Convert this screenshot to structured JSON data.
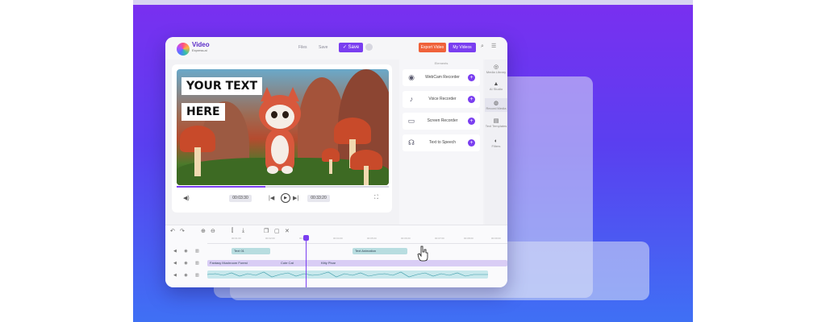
{
  "app": {
    "logo_text": "Video",
    "logo_sub": "Express.ai"
  },
  "toolbar": {
    "files_label": "Files",
    "save_small_label": "Save",
    "save_label": "✓ Save",
    "export_label": "Export Video",
    "my_videos_label": "My Videos"
  },
  "preview": {
    "text_line1": "YOUR TEXT",
    "text_line2": "HERE",
    "current_time": "00:03:30",
    "total_time": "00:33:20",
    "progress": 0.42
  },
  "recorders": {
    "header": "Elements",
    "items": [
      {
        "label": "WebCam Recorder",
        "icon": "webcam-icon",
        "symbol": "◉"
      },
      {
        "label": "Voice Recorder",
        "icon": "microphone-icon",
        "symbol": "♪"
      },
      {
        "label": "Screen Recorder",
        "icon": "monitor-icon",
        "symbol": "▭"
      },
      {
        "label": "Text to Speech",
        "icon": "speech-icon",
        "symbol": "☊"
      }
    ]
  },
  "rail": {
    "items": [
      {
        "label": "Media Library",
        "icon": "media-icon",
        "symbol": "◎"
      },
      {
        "label": "AI Studio",
        "icon": "ai-icon",
        "symbol": "▲"
      },
      {
        "label": "Record Media",
        "icon": "record-icon",
        "symbol": "◍"
      },
      {
        "label": "Text Templates",
        "icon": "text-icon",
        "symbol": "▤"
      },
      {
        "label": "Filters",
        "icon": "filter-icon",
        "symbol": "◐"
      }
    ]
  },
  "timeline": {
    "ticks": [
      "00:01:00",
      "00:02:00",
      "00:03:00",
      "00:04:00",
      "00:05:00",
      "00:06:00",
      "00:07:00",
      "00:08:00",
      "00:09:00"
    ],
    "clips": {
      "text1": "Text 01",
      "text2": "Text Animation",
      "video1": "Fantasy Mushroom Forest",
      "video2": "Cute Cat",
      "video3": "Kitty Pixar"
    }
  },
  "colors": {
    "accent": "#7a3ef0",
    "export": "#f0623a",
    "background_top": "#7a2ff0",
    "background_bottom": "#3f70f4"
  }
}
